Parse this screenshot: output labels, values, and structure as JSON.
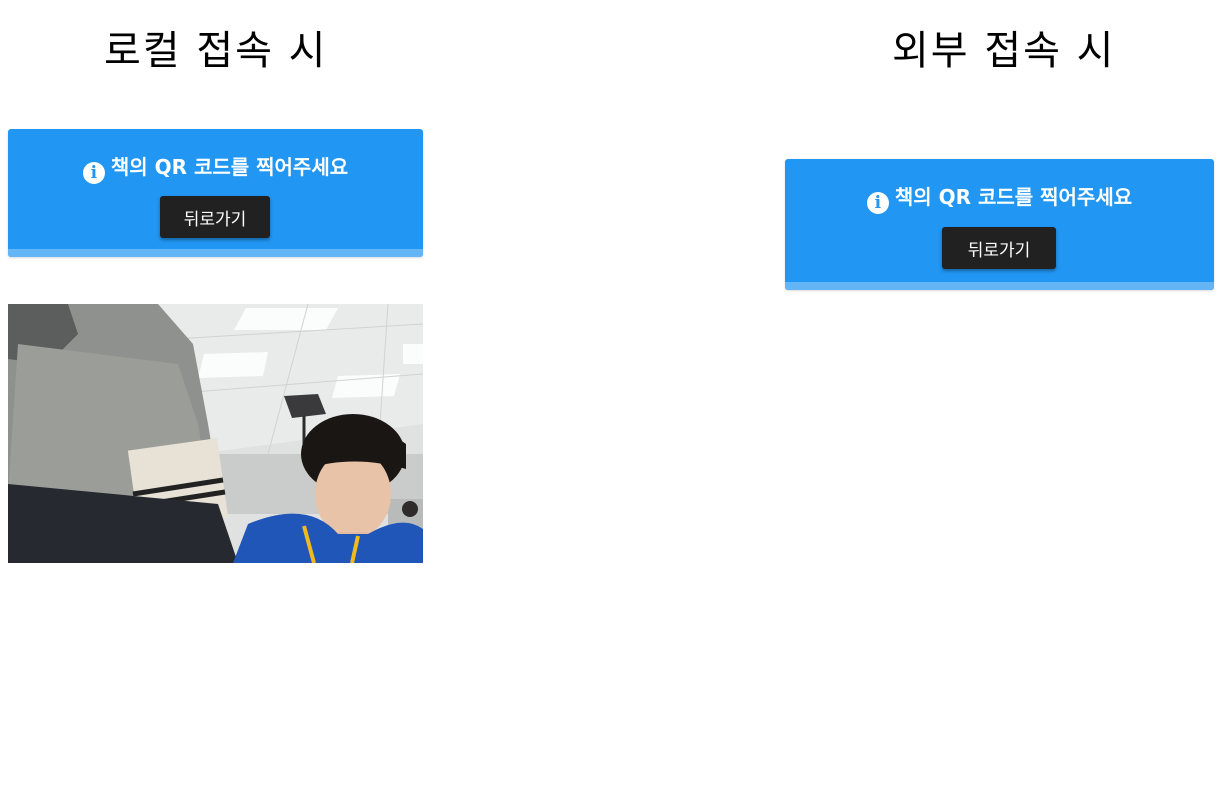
{
  "captions": {
    "local": "로컬 접속 시",
    "remote": "외부 접속 시"
  },
  "alert": {
    "icon": "info-circle-icon",
    "message": "책의 QR 코드를 찍어주세요",
    "back_label": "뒤로가기"
  },
  "colors": {
    "alert_bg": "#2196f3",
    "alert_bottom": "#64b5f6",
    "button_bg": "#212121"
  }
}
